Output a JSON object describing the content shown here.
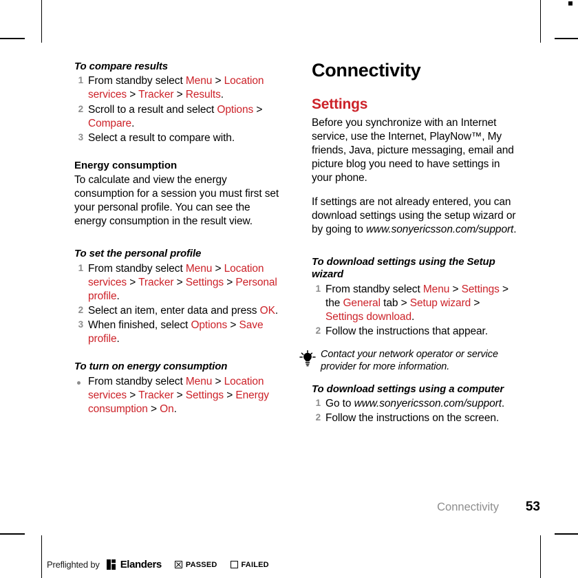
{
  "page": {
    "number": "53",
    "chapter_footer": "Connectivity"
  },
  "left_column": {
    "proc_compare": {
      "title": "To compare results",
      "steps": [
        {
          "parts": [
            {
              "t": "From standby select ",
              "s": "plain"
            },
            {
              "t": "Menu",
              "s": "ui"
            },
            {
              "t": " > ",
              "s": "plain"
            },
            {
              "t": "Location services",
              "s": "ui"
            },
            {
              "t": " > ",
              "s": "plain"
            },
            {
              "t": "Tracker",
              "s": "ui"
            },
            {
              "t": " > ",
              "s": "plain"
            },
            {
              "t": "Results",
              "s": "ui"
            },
            {
              "t": ".",
              "s": "plain"
            }
          ]
        },
        {
          "parts": [
            {
              "t": "Scroll to a result and select ",
              "s": "plain"
            },
            {
              "t": "Options",
              "s": "ui"
            },
            {
              "t": " > ",
              "s": "plain"
            },
            {
              "t": "Compare",
              "s": "ui"
            },
            {
              "t": ".",
              "s": "plain"
            }
          ]
        },
        {
          "parts": [
            {
              "t": "Select a result to compare with.",
              "s": "plain"
            }
          ]
        }
      ]
    },
    "energy_consumption": {
      "title": "Energy consumption",
      "body": "To calculate and view the energy consumption for a session you must first set your personal profile. You can see the energy consumption in the result view."
    },
    "proc_personal_profile": {
      "title": "To set the personal profile",
      "steps": [
        {
          "parts": [
            {
              "t": "From standby select ",
              "s": "plain"
            },
            {
              "t": "Menu",
              "s": "ui"
            },
            {
              "t": " > ",
              "s": "plain"
            },
            {
              "t": "Location services",
              "s": "ui"
            },
            {
              "t": " > ",
              "s": "plain"
            },
            {
              "t": "Tracker",
              "s": "ui"
            },
            {
              "t": " > ",
              "s": "plain"
            },
            {
              "t": "Settings",
              "s": "ui"
            },
            {
              "t": " > ",
              "s": "plain"
            },
            {
              "t": "Personal profile",
              "s": "ui"
            },
            {
              "t": ".",
              "s": "plain"
            }
          ]
        },
        {
          "parts": [
            {
              "t": "Select an item, enter data and press ",
              "s": "plain"
            },
            {
              "t": "OK",
              "s": "ui"
            },
            {
              "t": ".",
              "s": "plain"
            }
          ]
        },
        {
          "parts": [
            {
              "t": "When finished, select ",
              "s": "plain"
            },
            {
              "t": "Options",
              "s": "ui"
            },
            {
              "t": " > ",
              "s": "plain"
            },
            {
              "t": "Save profile",
              "s": "ui"
            },
            {
              "t": ".",
              "s": "plain"
            }
          ]
        }
      ]
    },
    "proc_turn_on_energy": {
      "title": "To turn on energy consumption",
      "bullets": [
        {
          "parts": [
            {
              "t": "From standby select ",
              "s": "plain"
            },
            {
              "t": "Menu",
              "s": "ui"
            },
            {
              "t": " > ",
              "s": "plain"
            },
            {
              "t": "Location services",
              "s": "ui"
            },
            {
              "t": " > ",
              "s": "plain"
            },
            {
              "t": "Tracker",
              "s": "ui"
            },
            {
              "t": " > ",
              "s": "plain"
            },
            {
              "t": "Settings",
              "s": "ui"
            },
            {
              "t": " > ",
              "s": "plain"
            },
            {
              "t": "Energy consumption",
              "s": "ui"
            },
            {
              "t": " > ",
              "s": "plain"
            },
            {
              "t": "On",
              "s": "ui"
            },
            {
              "t": ".",
              "s": "plain"
            }
          ]
        }
      ]
    }
  },
  "right_column": {
    "chapter_title": "Connectivity",
    "settings": {
      "title": "Settings",
      "paragraphs": [
        {
          "parts": [
            {
              "t": "Before you synchronize with an Internet service, use the Internet, PlayNow™, My friends, Java, picture messaging, email and picture blog you need to have settings in your phone.",
              "s": "plain"
            }
          ]
        },
        {
          "parts": [
            {
              "t": "If settings are not already entered, you can download settings using the setup wizard or by going to ",
              "s": "plain"
            },
            {
              "t": "www.sonyericsson.com/support",
              "s": "it"
            },
            {
              "t": ".",
              "s": "plain"
            }
          ]
        }
      ]
    },
    "proc_setup_wizard": {
      "title": "To download settings using the Setup wizard",
      "steps": [
        {
          "parts": [
            {
              "t": "From standby select ",
              "s": "plain"
            },
            {
              "t": "Menu",
              "s": "ui"
            },
            {
              "t": " > ",
              "s": "plain"
            },
            {
              "t": "Settings",
              "s": "ui"
            },
            {
              "t": " > the ",
              "s": "plain"
            },
            {
              "t": "General",
              "s": "ui"
            },
            {
              "t": " tab > ",
              "s": "plain"
            },
            {
              "t": "Setup wizard",
              "s": "ui"
            },
            {
              "t": " > ",
              "s": "plain"
            },
            {
              "t": "Settings download",
              "s": "ui"
            },
            {
              "t": ".",
              "s": "plain"
            }
          ]
        },
        {
          "parts": [
            {
              "t": "Follow the instructions that appear.",
              "s": "plain"
            }
          ]
        }
      ]
    },
    "tip": {
      "icon": "lightbulb-icon",
      "text": "Contact your network operator or service provider for more information."
    },
    "proc_download_computer": {
      "title": "To download settings using a computer",
      "steps": [
        {
          "parts": [
            {
              "t": "Go to ",
              "s": "plain"
            },
            {
              "t": "www.sonyericsson.com/support",
              "s": "it"
            },
            {
              "t": ".",
              "s": "plain"
            }
          ]
        },
        {
          "parts": [
            {
              "t": "Follow the instructions on the screen.",
              "s": "plain"
            }
          ]
        }
      ]
    }
  },
  "preflight": {
    "prefix": "Preflighted by",
    "brand": "Elanders",
    "passed_label": "PASSED",
    "failed_label": "FAILED",
    "passed_checked": true,
    "failed_checked": false
  },
  "colors": {
    "ui_red": "#cc2229",
    "step_number_gray": "#8c8c8c",
    "footer_gray": "#8e8e8e",
    "text_black": "#000000",
    "paper_white": "#ffffff"
  }
}
